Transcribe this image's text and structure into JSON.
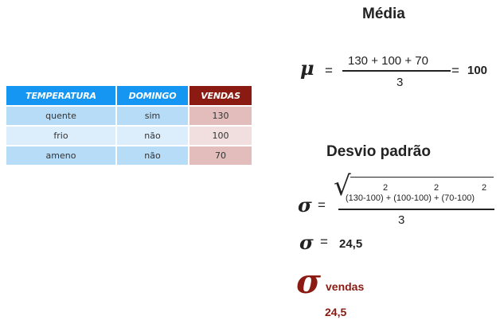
{
  "table": {
    "headers": [
      "TEMPERATURA",
      "DOMINGO",
      "VENDAS"
    ],
    "rows": [
      [
        "quente",
        "sim",
        "130"
      ],
      [
        "frio",
        "não",
        "100"
      ],
      [
        "ameno",
        "não",
        "70"
      ]
    ]
  },
  "mean": {
    "title": "Média",
    "symbol": "μ",
    "equals": "=",
    "numerator": "130 + 100 + 70",
    "denominator": "3",
    "result_equals": "=",
    "result": "100"
  },
  "stddev": {
    "title": "Desvio padrão",
    "symbol": "σ",
    "equals": "=",
    "sqrt_sign": "√",
    "radicand": "(130-100) + (100-100) + (70-100)",
    "exponents": [
      "2",
      "2",
      "2"
    ],
    "denominator": "3",
    "result_symbol": "σ",
    "result_equals": "=",
    "result": "24,5"
  },
  "highlight": {
    "symbol": "σ",
    "label": "vendas",
    "value": "24,5"
  },
  "colors": {
    "header_blue": "#1496f2",
    "header_red": "#8a1a12",
    "accent_text": "#8a1a12"
  }
}
